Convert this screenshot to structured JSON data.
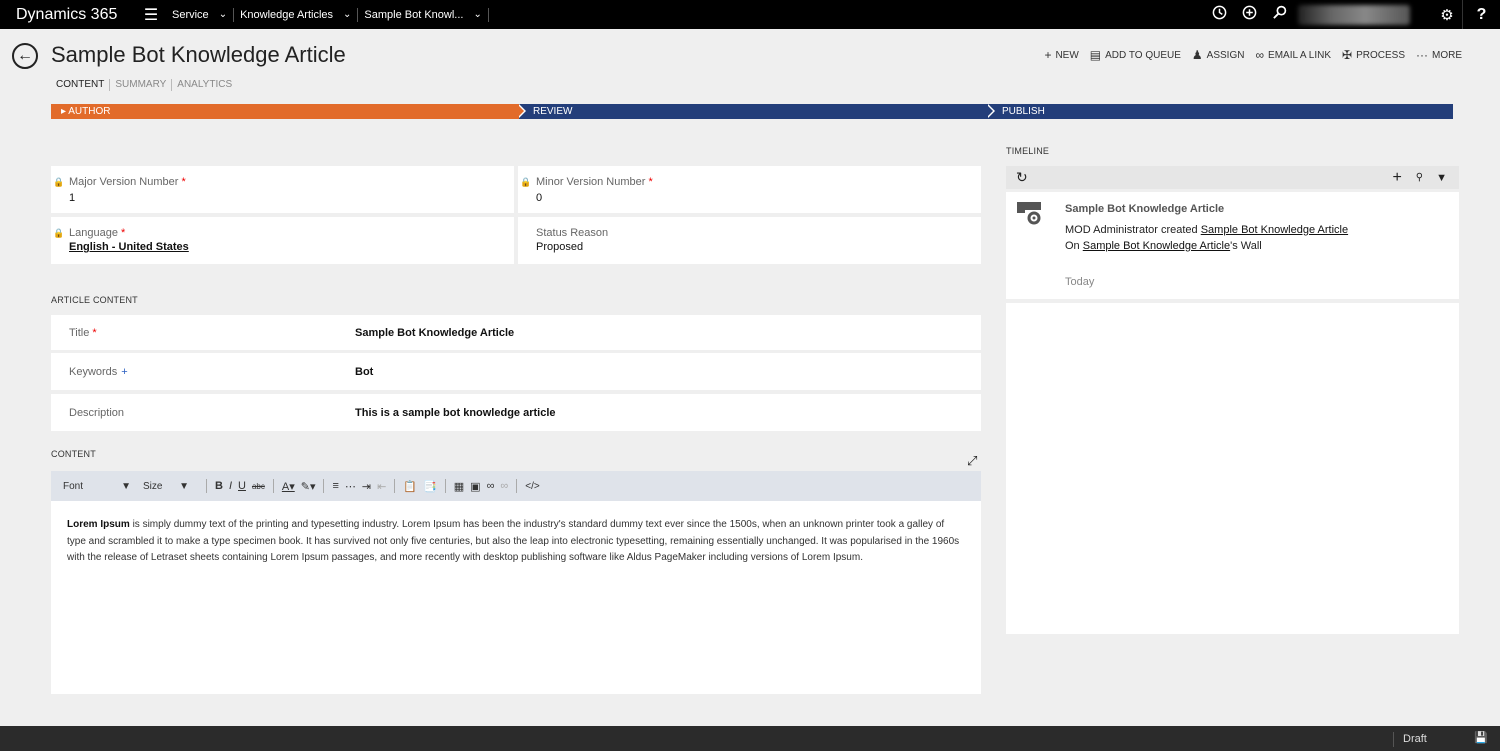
{
  "app": {
    "title": "Dynamics 365"
  },
  "nav": {
    "menu_icon": "hamburger-icon",
    "breadcrumbs": [
      {
        "label": "Service"
      },
      {
        "label": "Knowledge Articles"
      },
      {
        "label": "Sample Bot Knowl..."
      }
    ],
    "icons": [
      "history-icon",
      "add-icon",
      "search-icon",
      "settings-icon"
    ],
    "help": "?"
  },
  "header": {
    "title": "Sample Bot Knowledge Article",
    "tabs": [
      "CONTENT",
      "SUMMARY",
      "ANALYTICS"
    ]
  },
  "commands": [
    {
      "label": "NEW",
      "icon": "plus-icon"
    },
    {
      "label": "ADD TO QUEUE",
      "icon": "queue-icon"
    },
    {
      "label": "ASSIGN",
      "icon": "assign-icon"
    },
    {
      "label": "EMAIL A LINK",
      "icon": "link-icon"
    },
    {
      "label": "PROCESS",
      "icon": "process-icon"
    },
    {
      "label": "MORE",
      "icon": "ellipsis-icon"
    }
  ],
  "process": {
    "stages": [
      "AUTHOR",
      "REVIEW",
      "PUBLISH"
    ],
    "active_color": "#e26b2a",
    "inactive_color": "#233e7a"
  },
  "fields": {
    "major_version": {
      "label": "Major Version Number",
      "value": "1"
    },
    "minor_version": {
      "label": "Minor Version Number",
      "value": "0"
    },
    "language": {
      "label": "Language",
      "value": "English - United States"
    },
    "status_reason": {
      "label": "Status Reason",
      "value": "Proposed"
    }
  },
  "article_content": {
    "heading": "ARTICLE CONTENT",
    "title": {
      "label": "Title",
      "value": "Sample Bot Knowledge Article"
    },
    "keywords": {
      "label": "Keywords",
      "value": "Bot"
    },
    "description": {
      "label": "Description",
      "value": "This is a sample bot knowledge article"
    }
  },
  "content": {
    "heading": "CONTENT",
    "toolbar": {
      "font": "Font",
      "size": "Size"
    },
    "body_bold": "Lorem Ipsum",
    "body_text": " is simply dummy text of the printing and typesetting industry. Lorem Ipsum has been the industry's standard dummy text ever since the 1500s, when an unknown printer took a galley of type and scrambled it to make a type specimen book. It has survived not only five centuries, but also the leap into electronic typesetting, remaining essentially unchanged. It was popularised in the 1960s with the release of Letraset sheets containing Lorem Ipsum passages, and more recently with desktop publishing software like Aldus PageMaker including versions of Lorem Ipsum."
  },
  "timeline": {
    "heading": "TIMELINE",
    "entry": {
      "title": "Sample Bot Knowledge Article",
      "line1_prefix": "MOD Administrator created ",
      "line1_link": "Sample Bot Knowledge Article",
      "line2_prefix": "On ",
      "line2_link": "Sample Bot Knowledge Article",
      "line2_suffix": "'s Wall",
      "time": "Today"
    }
  },
  "footer": {
    "status": "Draft"
  }
}
